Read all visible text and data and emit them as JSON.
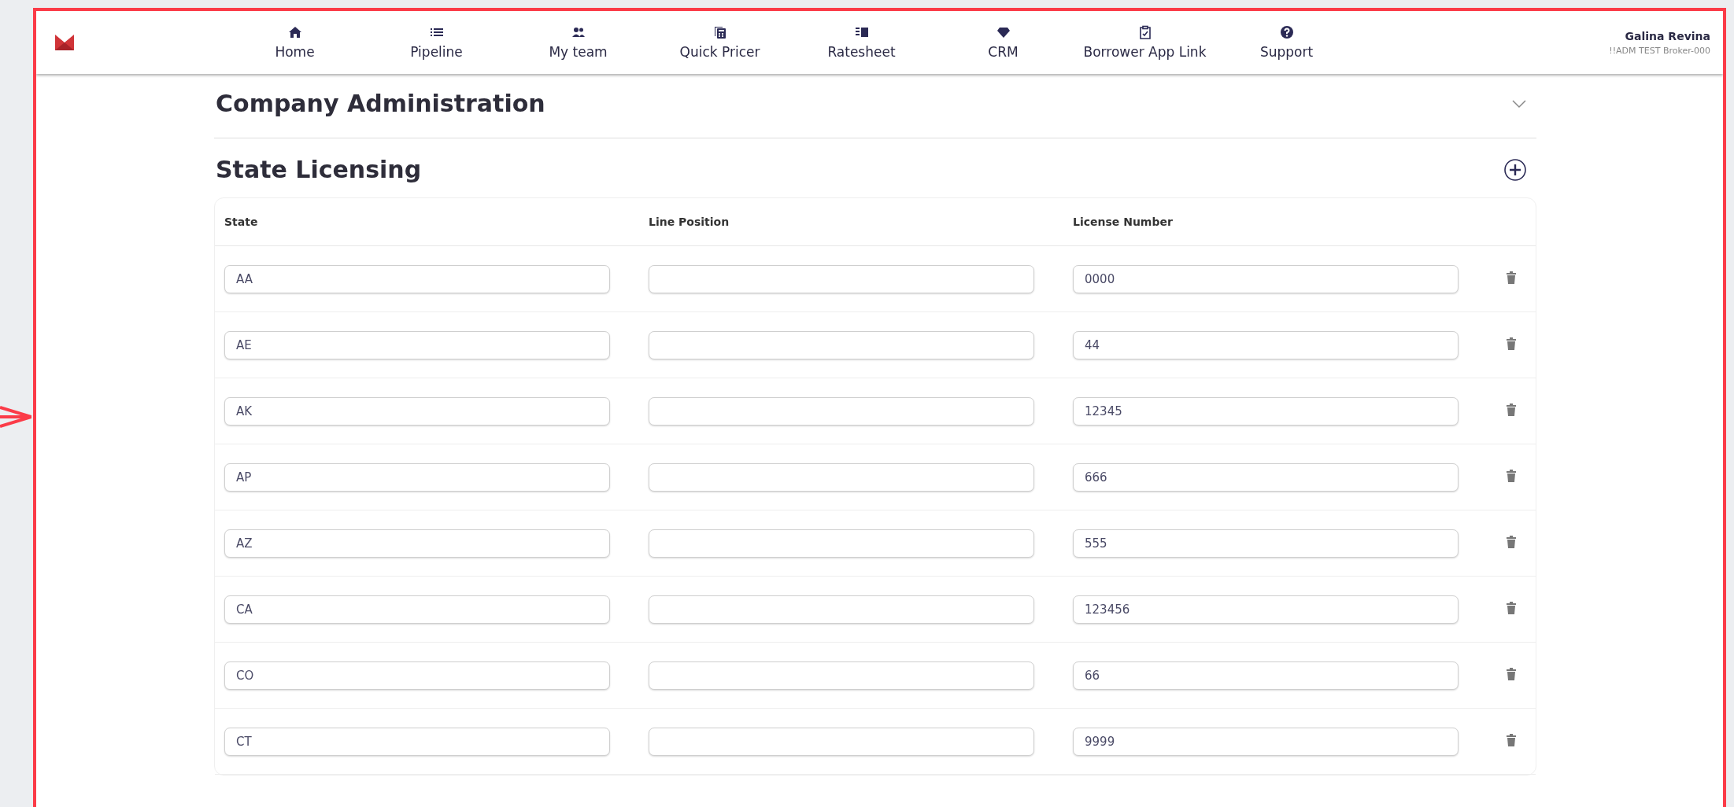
{
  "nav": [
    {
      "label": "Home"
    },
    {
      "label": "Pipeline"
    },
    {
      "label": "My team"
    },
    {
      "label": "Quick Pricer"
    },
    {
      "label": "Ratesheet"
    },
    {
      "label": "CRM"
    },
    {
      "label": "Borrower App Link"
    },
    {
      "label": "Support"
    }
  ],
  "user": {
    "name": "Galina Revina",
    "company": "!!ADM TEST Broker-000"
  },
  "sections": [
    {
      "title": "Company Administration",
      "expanded": false
    }
  ],
  "licensing": {
    "title": "State Licensing",
    "columns": [
      "State",
      "Line Position",
      "License Number"
    ],
    "rows": [
      {
        "state": "AA",
        "license_number": "0000"
      },
      {
        "state": "AE",
        "license_number": "44"
      },
      {
        "state": "AK",
        "license_number": "12345"
      },
      {
        "state": "AP",
        "license_number": "666"
      },
      {
        "state": "AZ",
        "license_number": "555"
      },
      {
        "state": "CA",
        "license_number": "123456"
      },
      {
        "state": "CO",
        "license_number": "66"
      },
      {
        "state": "CT",
        "license_number": "9999"
      }
    ]
  }
}
